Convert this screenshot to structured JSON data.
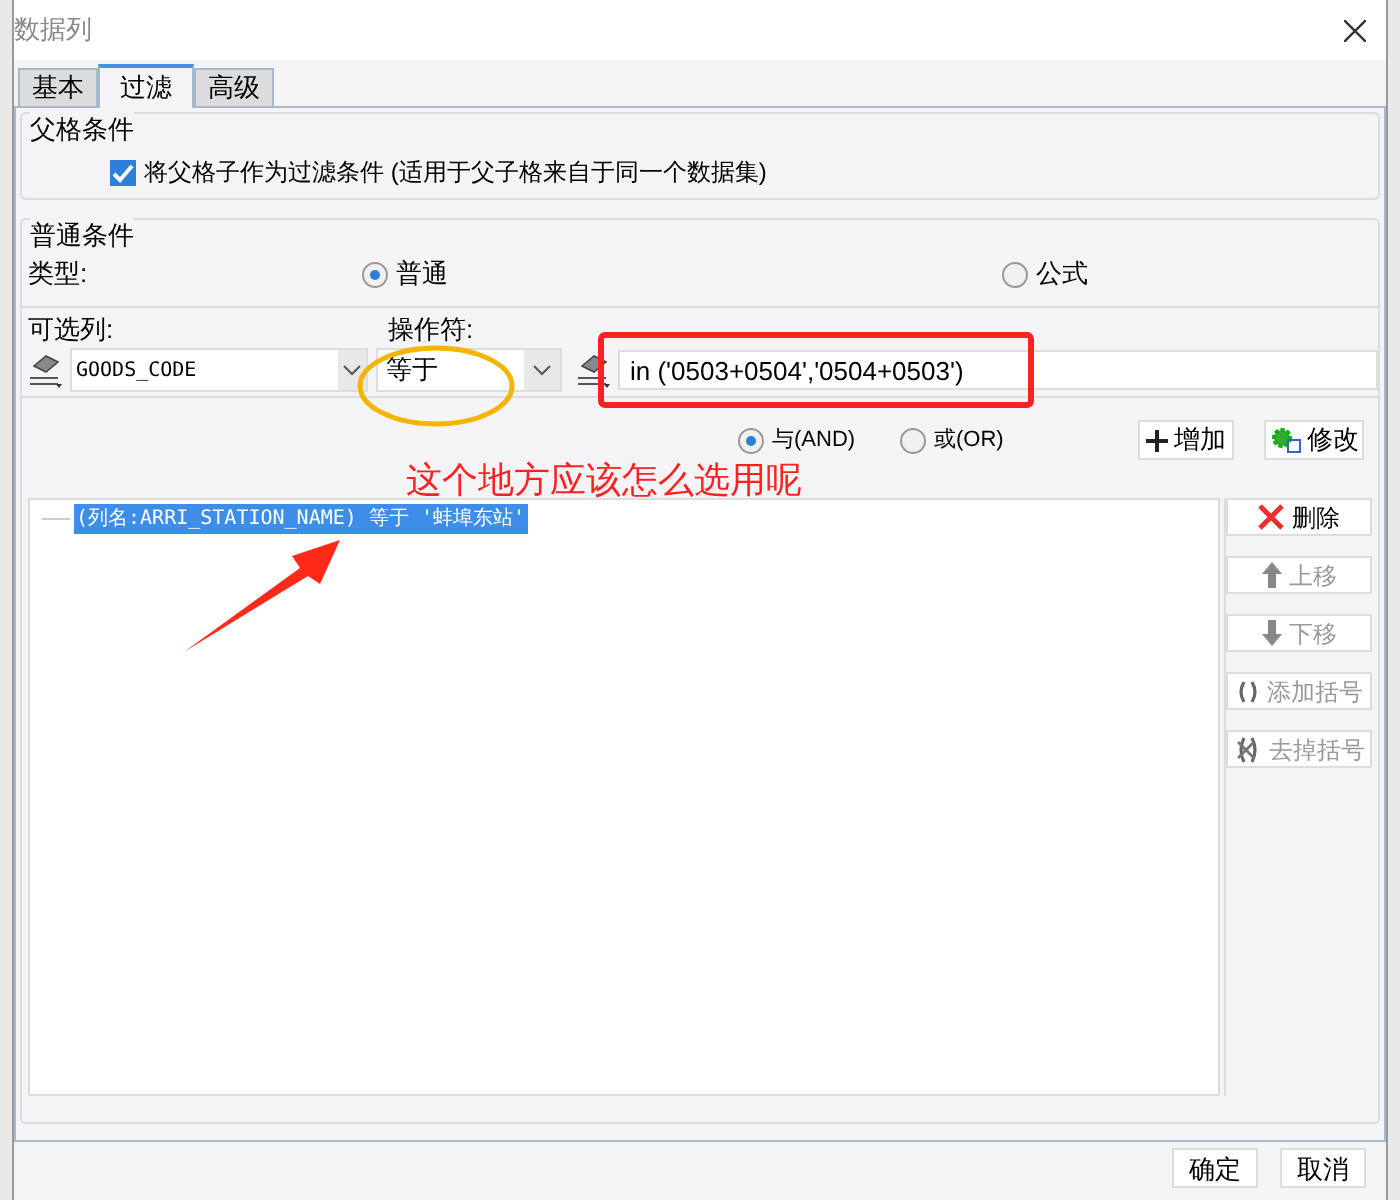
{
  "window": {
    "title": "数据列"
  },
  "tabs": [
    {
      "label": "基本",
      "selected": false
    },
    {
      "label": "过滤",
      "selected": true
    },
    {
      "label": "高级",
      "selected": false
    }
  ],
  "parent_group": {
    "legend": "父格条件",
    "checkbox": {
      "label": "将父格子作为过滤条件 (适用于父子格来自于同一个数据集)",
      "checked": true
    }
  },
  "normal_group": {
    "legend": "普通条件",
    "type_label": "类型:",
    "type_options": [
      {
        "label": "普通",
        "selected": true
      },
      {
        "label": "公式",
        "selected": false
      }
    ],
    "column_label": "可选列:",
    "operator_label": "操作符:",
    "column_value": "GOODS_CODE",
    "operator_value": "等于",
    "value_input": "in ('0503+0504','0504+0503')",
    "logic_options": [
      {
        "label": "与(AND)",
        "selected": true
      },
      {
        "label": "或(OR)",
        "selected": false
      }
    ],
    "add_button": "增加",
    "edit_button": "修改",
    "conditions": [
      {
        "text": "(列名:ARRI_STATION_NAME) 等于 '蚌埠东站'",
        "selected": true
      }
    ],
    "side_buttons": [
      {
        "kind": "delete",
        "label": "删除",
        "disabled": false
      },
      {
        "kind": "up",
        "label": "上移",
        "disabled": true
      },
      {
        "kind": "down",
        "label": "下移",
        "disabled": true
      },
      {
        "kind": "add-bracket",
        "label": "添加括号",
        "disabled": true
      },
      {
        "kind": "remove-bracket",
        "label": "去掉括号",
        "disabled": true
      }
    ]
  },
  "footer_buttons": [
    "确定",
    "取消"
  ],
  "annotation": {
    "text": "这个地方应该怎么选用呢"
  }
}
